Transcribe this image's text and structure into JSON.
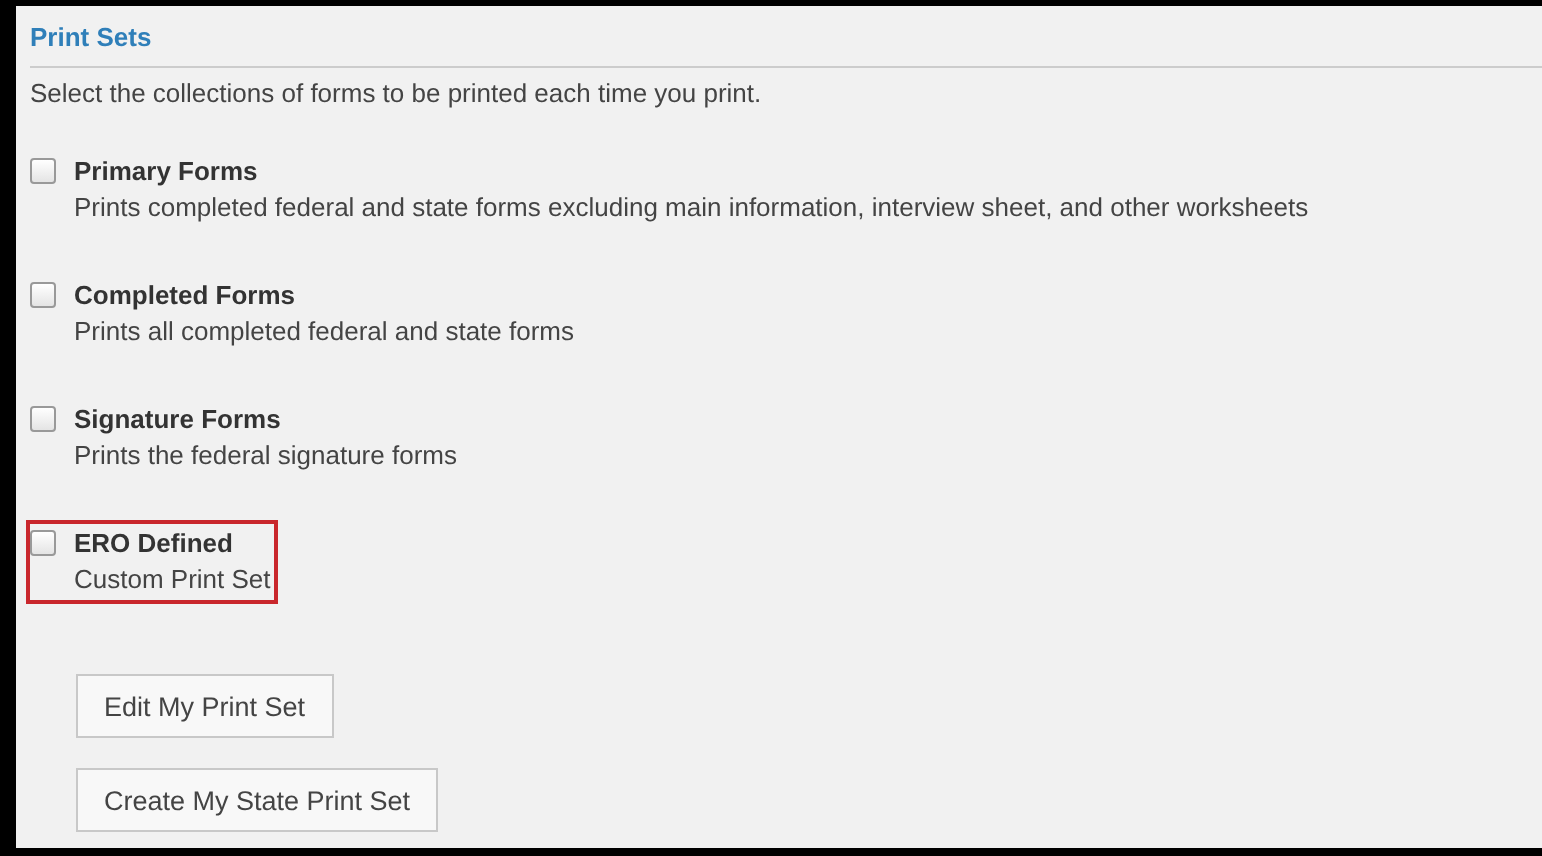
{
  "title": "Print Sets",
  "description": "Select the collections of forms to be printed each time you print.",
  "options": [
    {
      "label": "Primary Forms",
      "detail": "Prints completed federal and state forms excluding main information, interview sheet, and other worksheets",
      "checked": false,
      "highlighted": false
    },
    {
      "label": "Completed Forms",
      "detail": "Prints all completed federal and state forms",
      "checked": false,
      "highlighted": false
    },
    {
      "label": "Signature Forms",
      "detail": "Prints the federal signature forms",
      "checked": false,
      "highlighted": false
    },
    {
      "label": "ERO Defined",
      "detail": "Custom Print Set",
      "checked": false,
      "highlighted": true
    }
  ],
  "buttons": [
    "Edit My Print Set",
    "Create My State Print Set"
  ]
}
